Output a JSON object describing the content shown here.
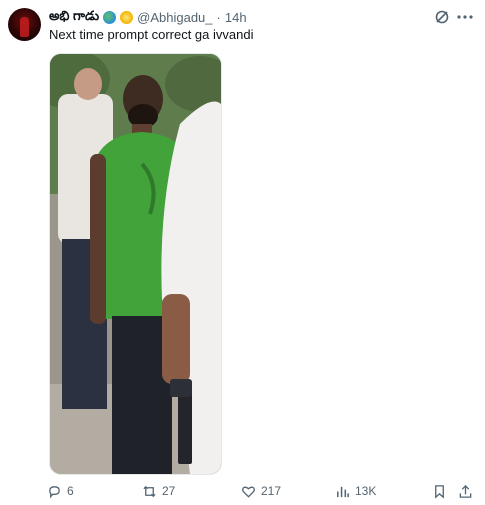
{
  "post": {
    "display_name": "అభి గాడు",
    "handle": "@Abhigadu_",
    "separator": "·",
    "time": "14h",
    "text": "Next time prompt correct ga ivvandi"
  },
  "actions": {
    "replies": "6",
    "reposts": "27",
    "likes": "217",
    "views": "13K"
  },
  "icons": {
    "grok": "grok-icon",
    "more": "more-icon",
    "reply": "reply-icon",
    "repost": "repost-icon",
    "like": "heart-icon",
    "views": "views-icon",
    "bookmark": "bookmark-icon",
    "share": "share-icon"
  },
  "colors": {
    "text": "#0f1419",
    "muted": "#536471"
  }
}
